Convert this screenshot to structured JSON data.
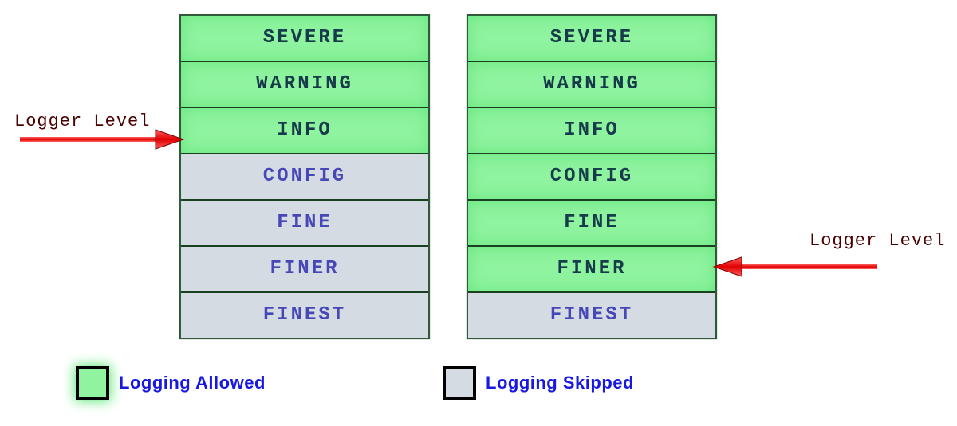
{
  "levels": [
    "SEVERE",
    "WARNING",
    "INFO",
    "CONFIG",
    "FINE",
    "FINER",
    "FINEST"
  ],
  "left_stack": {
    "logger_level": "INFO",
    "allowed": [
      "SEVERE",
      "WARNING",
      "INFO"
    ],
    "skipped": [
      "CONFIG",
      "FINE",
      "FINER",
      "FINEST"
    ]
  },
  "right_stack": {
    "logger_level": "FINER",
    "allowed": [
      "SEVERE",
      "WARNING",
      "INFO",
      "CONFIG",
      "FINE",
      "FINER"
    ],
    "skipped": [
      "FINEST"
    ]
  },
  "labels": {
    "logger_level_left": "Logger Level",
    "logger_level_right": "Logger Level"
  },
  "legend": {
    "allowed": "Logging Allowed",
    "skipped": "Logging Skipped"
  },
  "colors": {
    "allowed_bg": "#8ff39f",
    "skipped_bg": "#d5dbe2",
    "arrow": "#ff0000",
    "legend_text": "#1818e0"
  }
}
